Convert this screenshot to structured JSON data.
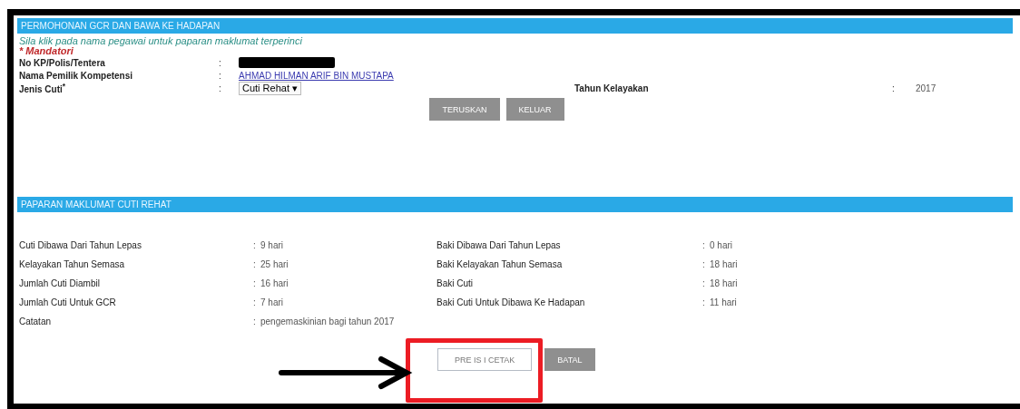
{
  "section_1": {
    "title": "PERMOHONAN GCR DAN BAWA KE HADAPAN",
    "instruction": "Sila klik pada nama pegawai untuk paparan maklumat terperinci",
    "mandatory_note": "* Mandatori",
    "fields": [
      {
        "label": "No KP/Polis/Tentera",
        "colon": ":",
        "kind": "redacted"
      },
      {
        "label": "Nama Pemilik Kompetensi",
        "colon": ":",
        "kind": "link",
        "value": "AHMAD HILMAN ARIF BIN MUSTAPA"
      },
      {
        "label": "Jenis Cuti$^{*}$",
        "colon": ":",
        "kind": "select",
        "value": "Cuti Rehat ▾"
      }
    ],
    "year_field": {
      "label": "Tahun Kelayakan",
      "colon": ":",
      "value": "2017"
    },
    "buttons": [
      {
        "label": "TERUSKAN",
        "kind": "filled"
      },
      {
        "label": "KELUAR",
        "kind": "filled"
      }
    ]
  },
  "section_2": {
    "title": "PAPARAN MAKLUMAT CUTI REHAT",
    "rows": [
      {
        "label": "Cuti Dibawa Dari Tahun Lepas",
        "colon": ":",
        "value": "9  hari",
        "label_2": "Baki Dibawa Dari Tahun Lepas",
        "colon_2": ":",
        "value_2": "0  hari"
      },
      {
        "label": "Kelayakan Tahun Semasa",
        "colon": ":",
        "value": "25 hari",
        "label_2": "Baki Kelayakan Tahun Semasa",
        "colon_2": ":",
        "value_2": "18 hari"
      },
      {
        "label": "Jumlah Cuti Diambil",
        "colon": ":",
        "value": "16 hari",
        "label_2": "Baki Cuti",
        "colon_2": ":",
        "value_2": "18  hari"
      },
      {
        "label": "Jumlah Cuti Untuk GCR",
        "colon": ":",
        "value": "7  hari",
        "label_2": "Baki Cuti Untuk Dibawa Ke Hadapan",
        "colon_2": ":",
        "value_2": "11 hari"
      },
      {
        "label": "Catatan",
        "colon": ":",
        "value": "pengemaskinian bagi tahun 2017"
      }
    ],
    "buttons": [
      {
        "label": "PRE IS I CETAK",
        "kind": "outlined"
      },
      {
        "label": "BATAL",
        "kind": "filled"
      }
    ]
  }
}
